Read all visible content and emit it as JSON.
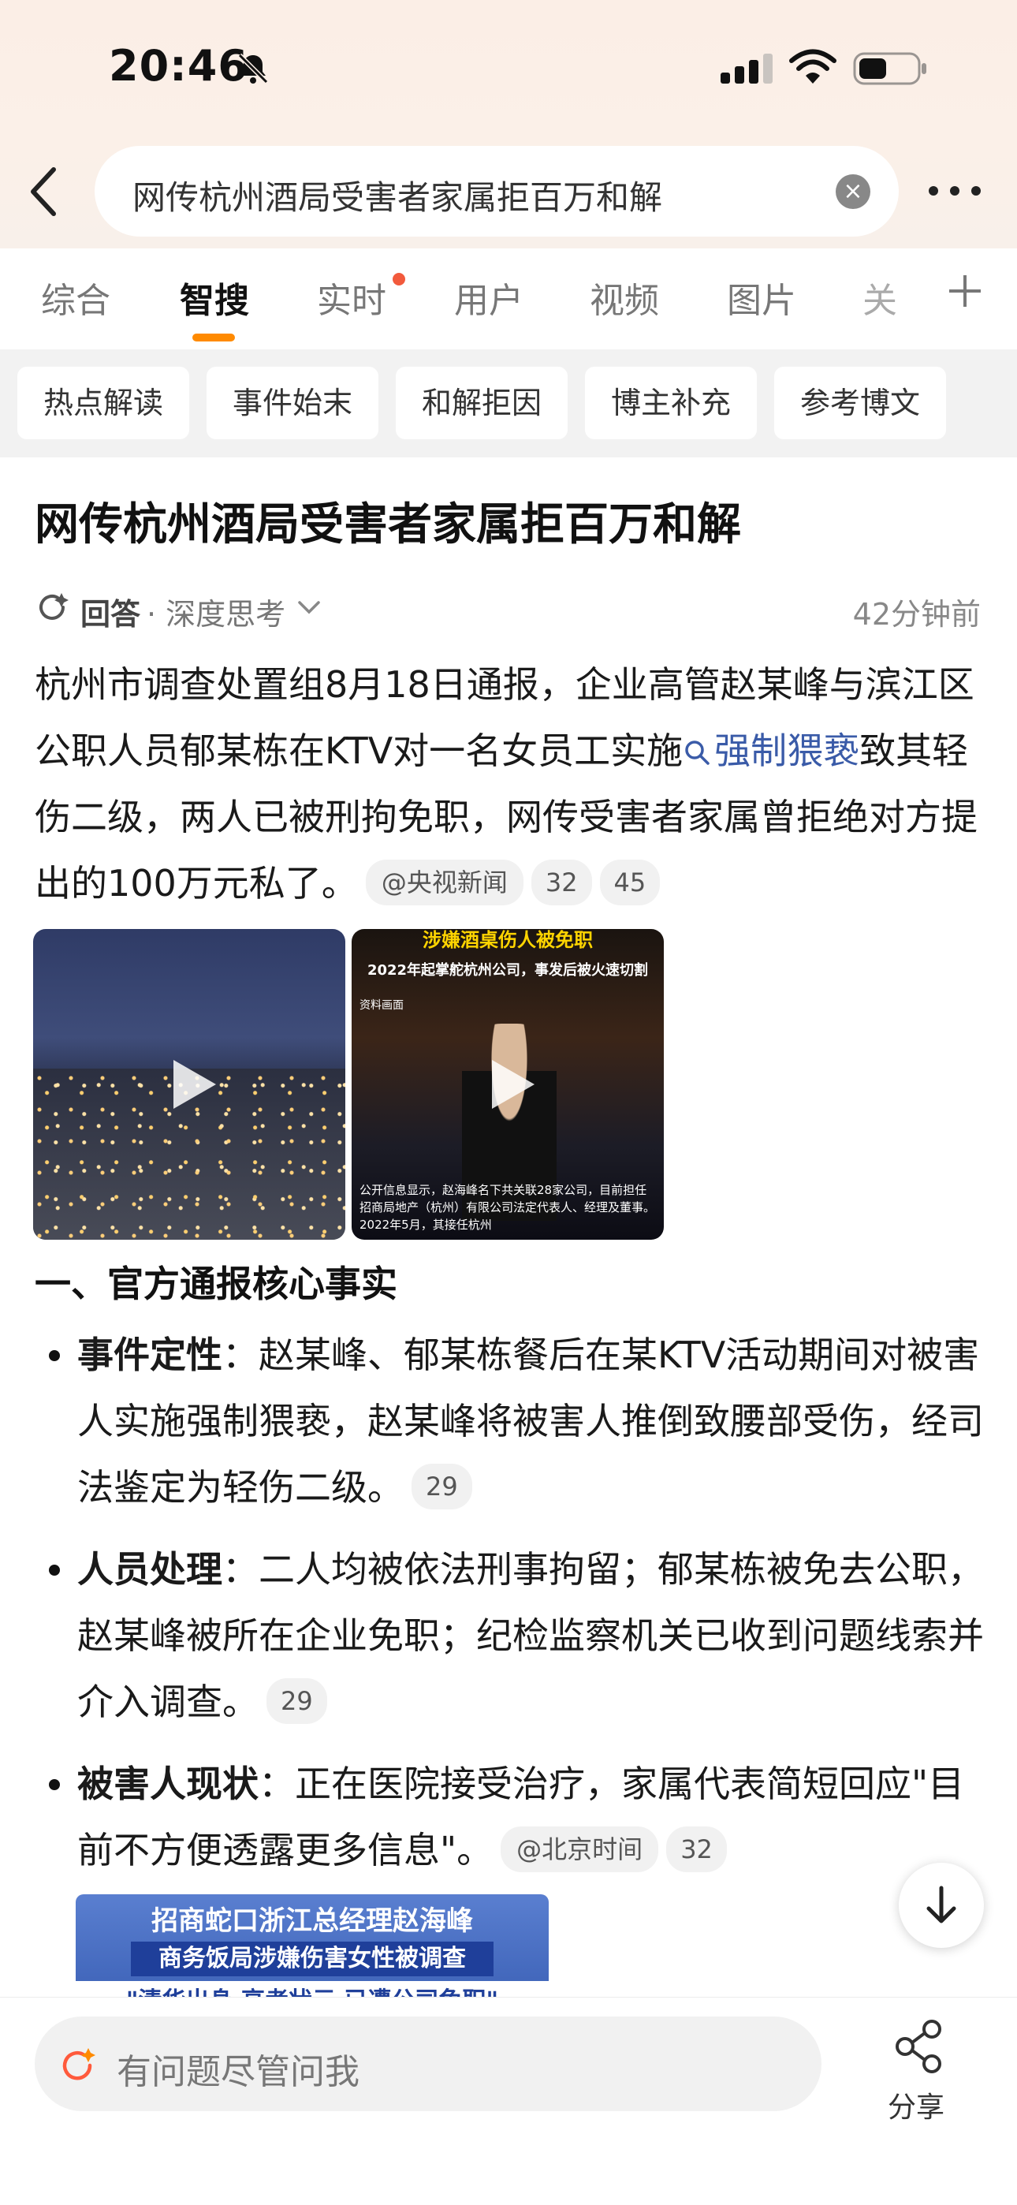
{
  "status_bar": {
    "time": "20:46"
  },
  "search": {
    "query": "网传杭州酒局受害者家属拒百万和解"
  },
  "tabs": [
    {
      "label": "综合"
    },
    {
      "label": "智搜"
    },
    {
      "label": "实时"
    },
    {
      "label": "用户"
    },
    {
      "label": "视频"
    },
    {
      "label": "图片"
    },
    {
      "label": "关"
    }
  ],
  "chips": [
    {
      "label": "热点解读"
    },
    {
      "label": "事件始末"
    },
    {
      "label": "和解拒因"
    },
    {
      "label": "博主补充"
    },
    {
      "label": "参考博文"
    }
  ],
  "article": {
    "title": "网传杭州酒局受害者家属拒百万和解",
    "answer_label": "回答",
    "mode_label": "· 深度思考",
    "time": "42分钟前",
    "intro_1": "杭州市调查处置组8月18日通报，企业高管赵某峰与滨江区公职人员郁某栋在KTV对一名女员工实施",
    "intro_link": "强制猥亵",
    "intro_2": "致其轻伤二级，两人已被刑拘免职，网传受害者家属曾拒绝对方提出的100万元私了。",
    "intro_source": "@央视新闻",
    "intro_num1": "32",
    "intro_num2": "45",
    "video2": {
      "headline": "涉嫌酒桌伤人被免职",
      "sub": "2022年起掌舵杭州公司，事发后被火速切割",
      "tag": "资料画面",
      "caption": "公开信息显示，赵海峰名下共关联28家公司，目前担任招商局地产（杭州）有限公司法定代表人、经理及董事。2022年5月，其接任杭州"
    },
    "section_heading": "一、官方通报核心事实",
    "bullets": [
      {
        "label": "事件定性",
        "text": "：赵某峰、郁某栋餐后在某KTV活动期间对被害人实施强制猥亵，赵某峰将被害人推倒致腰部受伤，经司法鉴定为轻伤二级。",
        "num": "29"
      },
      {
        "label": "人员处理",
        "text": "：二人均被依法刑事拘留；郁某栋被免去公职，赵某峰被所在企业免职；纪检监察机关已收到问题线索并介入调查。",
        "num": "29"
      },
      {
        "label": "被害人现状",
        "text": "：正在医院接受治疗，家属代表简短回应\"目前不方便透露更多信息\"。",
        "source": "@北京时间",
        "num": "32"
      }
    ],
    "bottom_image": {
      "line1": "招商蛇口浙江总经理赵海峰",
      "line2": "商务饭局涉嫌伤害女性被调查",
      "line3": "\"清华出身 高考状元 已遭公司免职\""
    }
  },
  "bottom_bar": {
    "ask_placeholder": "有问题尽管问我",
    "share_label": "分享"
  },
  "colors": {
    "accent": "#ff8a00",
    "link": "#3a5ba8",
    "header_bg": "#fbeee6"
  }
}
